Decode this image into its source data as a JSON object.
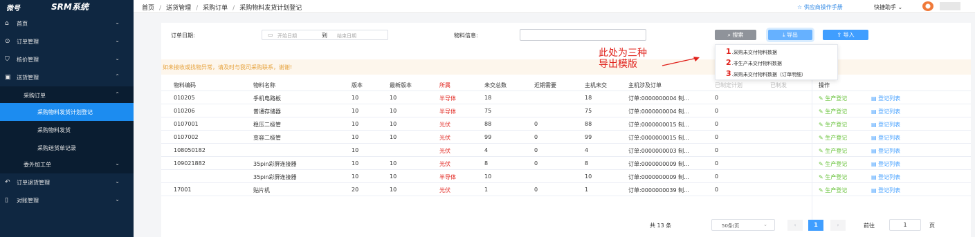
{
  "brand": {
    "logo": "微号",
    "system_name": "SRM系统"
  },
  "breadcrumb": [
    "首页",
    "送货管理",
    "采购订单",
    "采购物料发货计划登记"
  ],
  "header": {
    "manual_link": "供应商操作手册",
    "helper": "快捷助手"
  },
  "sidebar": {
    "items": [
      {
        "label": "首页",
        "icon": "home-icon"
      },
      {
        "label": "订单管理",
        "icon": "check-circle-icon"
      },
      {
        "label": "核价管理",
        "icon": "shield-icon"
      },
      {
        "label": "送货管理",
        "icon": "calendar-icon"
      },
      {
        "label": "采购订单"
      },
      {
        "label": "采购物料发货计划登记"
      },
      {
        "label": "采购物料发货"
      },
      {
        "label": "采购送货单记录"
      },
      {
        "label": "委外加工单"
      },
      {
        "label": "订单退货管理",
        "icon": "return-icon"
      },
      {
        "label": "对账管理",
        "icon": "document-icon"
      }
    ]
  },
  "filters": {
    "order_date_label": "订单日期:",
    "start_placeholder": "开始日期",
    "range_separator": "到",
    "end_placeholder": "结束日期",
    "material_label": "物料信息:",
    "material_value": ""
  },
  "toolbar": {
    "search": "搜索",
    "export": "导出",
    "import": "导入"
  },
  "export_menu": [
    {
      "num": "1",
      "label": "采购未交付物料数据"
    },
    {
      "num": "2",
      "label": "非生产未交付物料数据"
    },
    {
      "num": "3",
      "label": "采购未交付物料数据（订单明细）"
    }
  ],
  "annotation": {
    "line1": "此处为三种",
    "line2": "导出模版"
  },
  "notice": "如未接收或找物异常，请及时与我司采购联系，谢谢!",
  "table": {
    "headers": [
      "物料编码",
      "物料名称",
      "版本",
      "最新版本",
      "所属",
      "未交总数",
      "近期需要",
      "主机未交",
      "主机涉及订单",
      "已制定计划",
      "已制发",
      "操作"
    ],
    "rows": [
      [
        "010205",
        "手机电路板",
        "10",
        "10",
        "半导体",
        "18",
        "",
        "18",
        "订单:0000000004 制...",
        "0"
      ],
      [
        "010206",
        "普通存储器",
        "10",
        "10",
        "半导体",
        "75",
        "",
        "75",
        "订单:0000000004 制...",
        "0"
      ],
      [
        "0107001",
        "稳压二极管",
        "10",
        "10",
        "光伏",
        "88",
        "0",
        "88",
        "订单:0000000015 制...",
        "0"
      ],
      [
        "0107002",
        "变容二极管",
        "10",
        "10",
        "光伏",
        "99",
        "0",
        "99",
        "订单:0000000015 制...",
        "0"
      ],
      [
        "108050182",
        "",
        "10",
        "",
        "光伏",
        "4",
        "0",
        "4",
        "订单:0000000003 制...",
        "0"
      ],
      [
        "109021882",
        "35pin彩屏连接器",
        "10",
        "10",
        "光伏",
        "8",
        "0",
        "8",
        "订单:0000000009 制...",
        "0"
      ],
      [
        "",
        "35pin彩屏连接器",
        "10",
        "10",
        "半导体",
        "10",
        "",
        "10",
        "订单:0000000009 制...",
        "0"
      ],
      [
        "17001",
        "贴片机",
        "20",
        "10",
        "光伏",
        "1",
        "0",
        "1",
        "订单:0000000039 制...",
        "0"
      ]
    ],
    "action_register": "生产登记",
    "action_list": "登记列表"
  },
  "pagination": {
    "total": "共 13 条",
    "page_size": "50条/页",
    "current_page": "1",
    "goto_label": "前往",
    "goto_value": "1",
    "page_suffix": "页"
  },
  "colors": {
    "sidebar_bg": "#0f2741",
    "active": "#1c8cf0",
    "primary": "#409eff",
    "annotation": "#e0201a"
  }
}
